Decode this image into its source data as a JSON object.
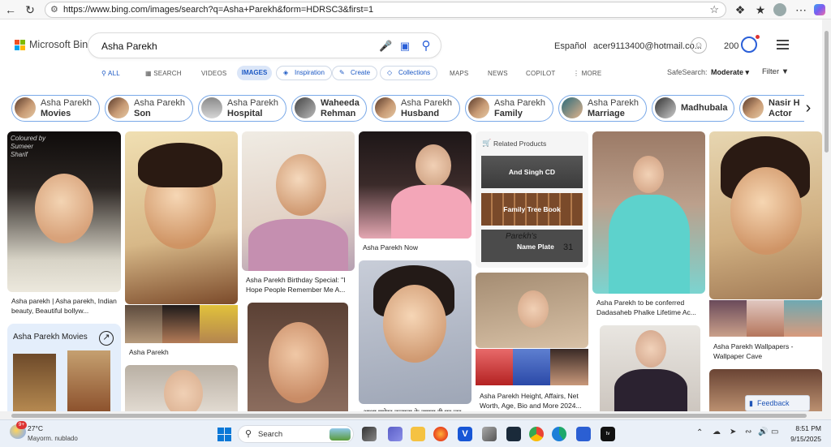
{
  "browser": {
    "url": "https://www.bing.com/images/search?q=Asha+Parekh&form=HDRSC3&first=1"
  },
  "header": {
    "brand": "Microsoft Bing",
    "query": "Asha Parekh",
    "language": "Español",
    "account": "acer9113400@hotmail.co...",
    "rewards": "200"
  },
  "nav": {
    "tabs": [
      "ALL",
      "SEARCH",
      "VIDEOS",
      "IMAGES",
      "Inspiration",
      "Create",
      "Collections",
      "MAPS",
      "NEWS",
      "COPILOT",
      "MORE"
    ],
    "safesearch_label": "SafeSearch:",
    "safesearch_value": "Moderate",
    "filter": "Filter"
  },
  "chips": [
    {
      "l1": "Asha Parekh",
      "l2": "Movies"
    },
    {
      "l1": "Asha Parekh",
      "l2": "Son"
    },
    {
      "l1": "Asha Parekh",
      "l2": "Hospital"
    },
    {
      "l1": "Waheeda",
      "l2": "Rehman"
    },
    {
      "l1": "Asha Parekh",
      "l2": "Husband"
    },
    {
      "l1": "Asha Parekh",
      "l2": "Family"
    },
    {
      "l1": "Asha Parekh",
      "l2": "Marriage"
    },
    {
      "single": "Madhubala"
    },
    {
      "l1": "Nasir Hu",
      "l2": "Actor"
    }
  ],
  "results": {
    "c1_cap": "Asha parekh | Asha parekh, Indian beauty, Beautiful bollyw...",
    "c1_movies": "Asha Parekh Movies",
    "c2_cap": "Asha Parekh",
    "c3_cap": "Asha Parekh Birthday Special: \"I Hope People Remember Me A...",
    "c4_cap": "Asha Parekh Now",
    "c4_bottom": "आशा पारेख कल्पना के वापस टी पर जर ... ",
    "related": "Related Products",
    "products": [
      "And Singh CD",
      "Family Tree Book",
      "Name Plate"
    ],
    "nameplate_text": "Parekh's",
    "nameplate_num": "31",
    "c5_cap": "Asha Parekh Height, Affairs, Net Worth, Age, Bio and More 2024...",
    "c6_cap": "Asha Parekh to be conferred Dadasaheb Phalke Lifetime Ac...",
    "c7_cap": "Asha Parekh Wallpapers - Wallpaper Cave",
    "c1_overlay": "Coloured by Sumeer Sharif",
    "feedback": "Feedback"
  },
  "taskbar": {
    "temp": "27°C",
    "weather": "Mayorm. nublado",
    "badge": "9+",
    "search": "Search",
    "time": "8:51 PM",
    "date": "9/15/2025"
  }
}
